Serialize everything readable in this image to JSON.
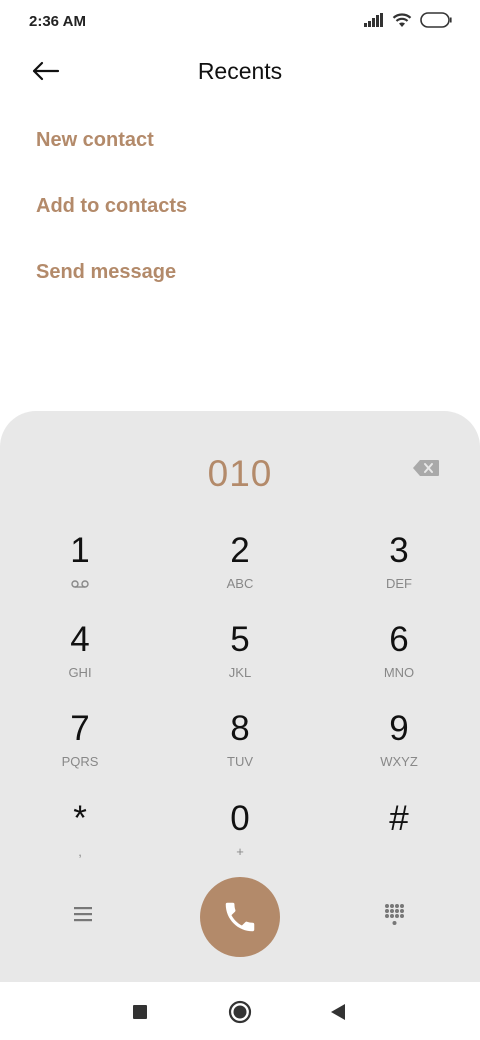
{
  "status_bar": {
    "time": "2:36 AM"
  },
  "header": {
    "title": "Recents"
  },
  "actions": [
    "New contact",
    "Add to contacts",
    "Send message"
  ],
  "dialer": {
    "number": "010",
    "keys": [
      {
        "digit": "1",
        "letters": ""
      },
      {
        "digit": "2",
        "letters": "ABC"
      },
      {
        "digit": "3",
        "letters": "DEF"
      },
      {
        "digit": "4",
        "letters": "GHI"
      },
      {
        "digit": "5",
        "letters": "JKL"
      },
      {
        "digit": "6",
        "letters": "MNO"
      },
      {
        "digit": "7",
        "letters": "PQRS"
      },
      {
        "digit": "8",
        "letters": "TUV"
      },
      {
        "digit": "9",
        "letters": "WXYZ"
      },
      {
        "digit": "*",
        "letters": ","
      },
      {
        "digit": "0",
        "letters": "+"
      },
      {
        "digit": "#",
        "letters": ""
      }
    ]
  },
  "colors": {
    "accent": "#b38a6a",
    "panel": "#e8e8e8"
  },
  "icons": [
    "signal-icon",
    "wifi-icon",
    "battery-icon",
    "back-arrow-icon",
    "backspace-icon",
    "voicemail-icon",
    "menu-icon",
    "phone-icon",
    "dialpad-icon",
    "recents-square-icon",
    "home-circle-icon",
    "back-triangle-icon"
  ]
}
